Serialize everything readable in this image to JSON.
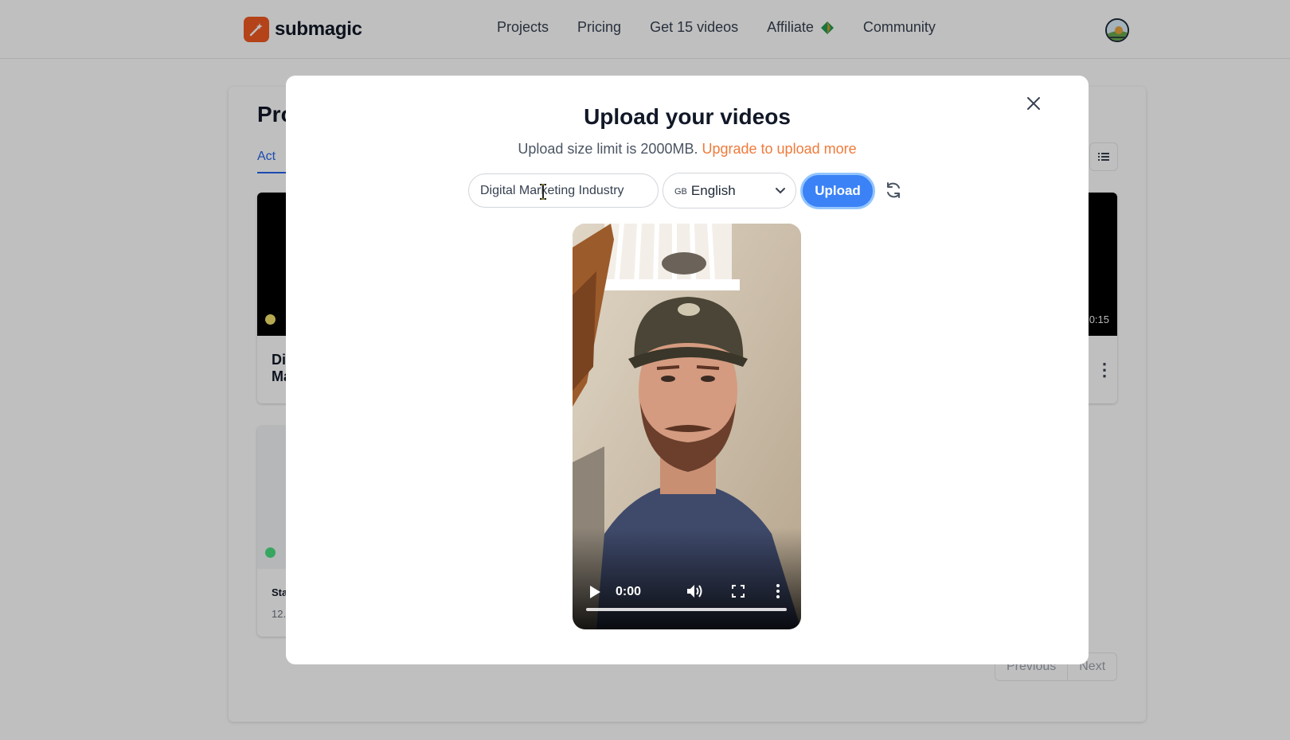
{
  "brand": {
    "name": "submagic",
    "accent": "#f05a22"
  },
  "nav": {
    "links": [
      "Projects",
      "Pricing",
      "Get 15 videos",
      "Affiliate",
      "Community"
    ]
  },
  "background": {
    "title": "Pro",
    "active_tab": "Act",
    "cards": [
      {
        "title_line1": "Di",
        "title_line2": "Ma",
        "duration": "0:15"
      },
      {
        "title": "Sta",
        "date": "12."
      }
    ],
    "pager": {
      "previous": "Previous",
      "next": "Next"
    }
  },
  "modal": {
    "title": "Upload your videos",
    "subtitle": "Upload size limit is 2000MB.",
    "upgrade_link": "Upgrade to upload more",
    "title_input": {
      "value": "Digital Marketing Industry"
    },
    "language": {
      "code": "GB",
      "name": "English"
    },
    "upload_label": "Upload",
    "video": {
      "time": "0:00"
    }
  },
  "colors": {
    "primary": "#3b82f6",
    "upgrade_link": "#f07a3a",
    "active_tab": "#2563eb"
  }
}
